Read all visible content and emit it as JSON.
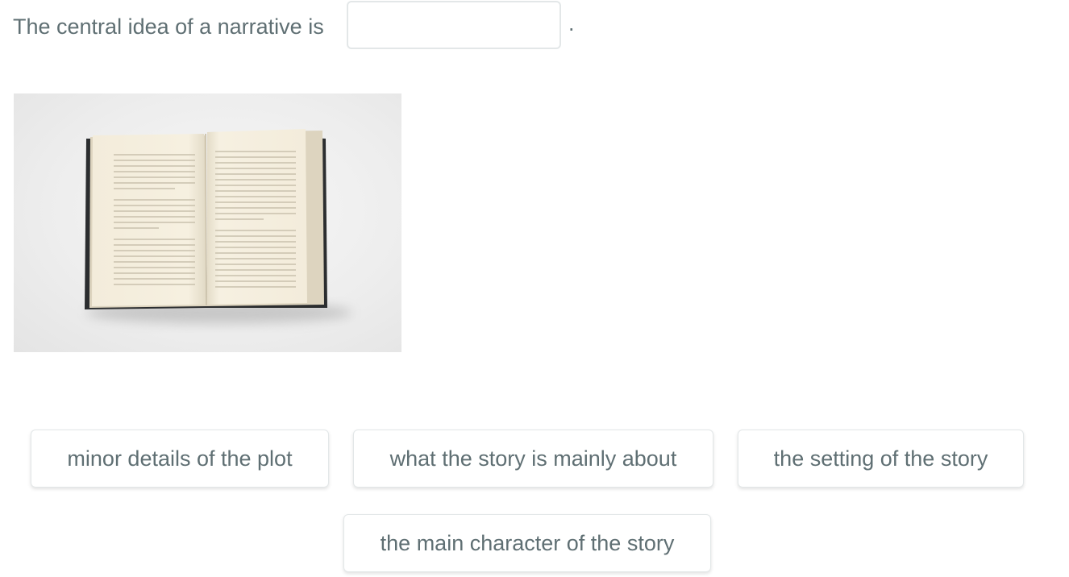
{
  "question": {
    "prefix": "The central idea of a narrative is",
    "suffix": "."
  },
  "image": {
    "description_icon": "open-book-icon"
  },
  "choices": [
    {
      "label": "minor details of the plot"
    },
    {
      "label": "what the story is mainly about"
    },
    {
      "label": "the setting of the story"
    },
    {
      "label": "the main character of the story"
    }
  ],
  "colors": {
    "text": "#5f6f73",
    "border": "#e3e7e8",
    "background": "#ffffff"
  }
}
